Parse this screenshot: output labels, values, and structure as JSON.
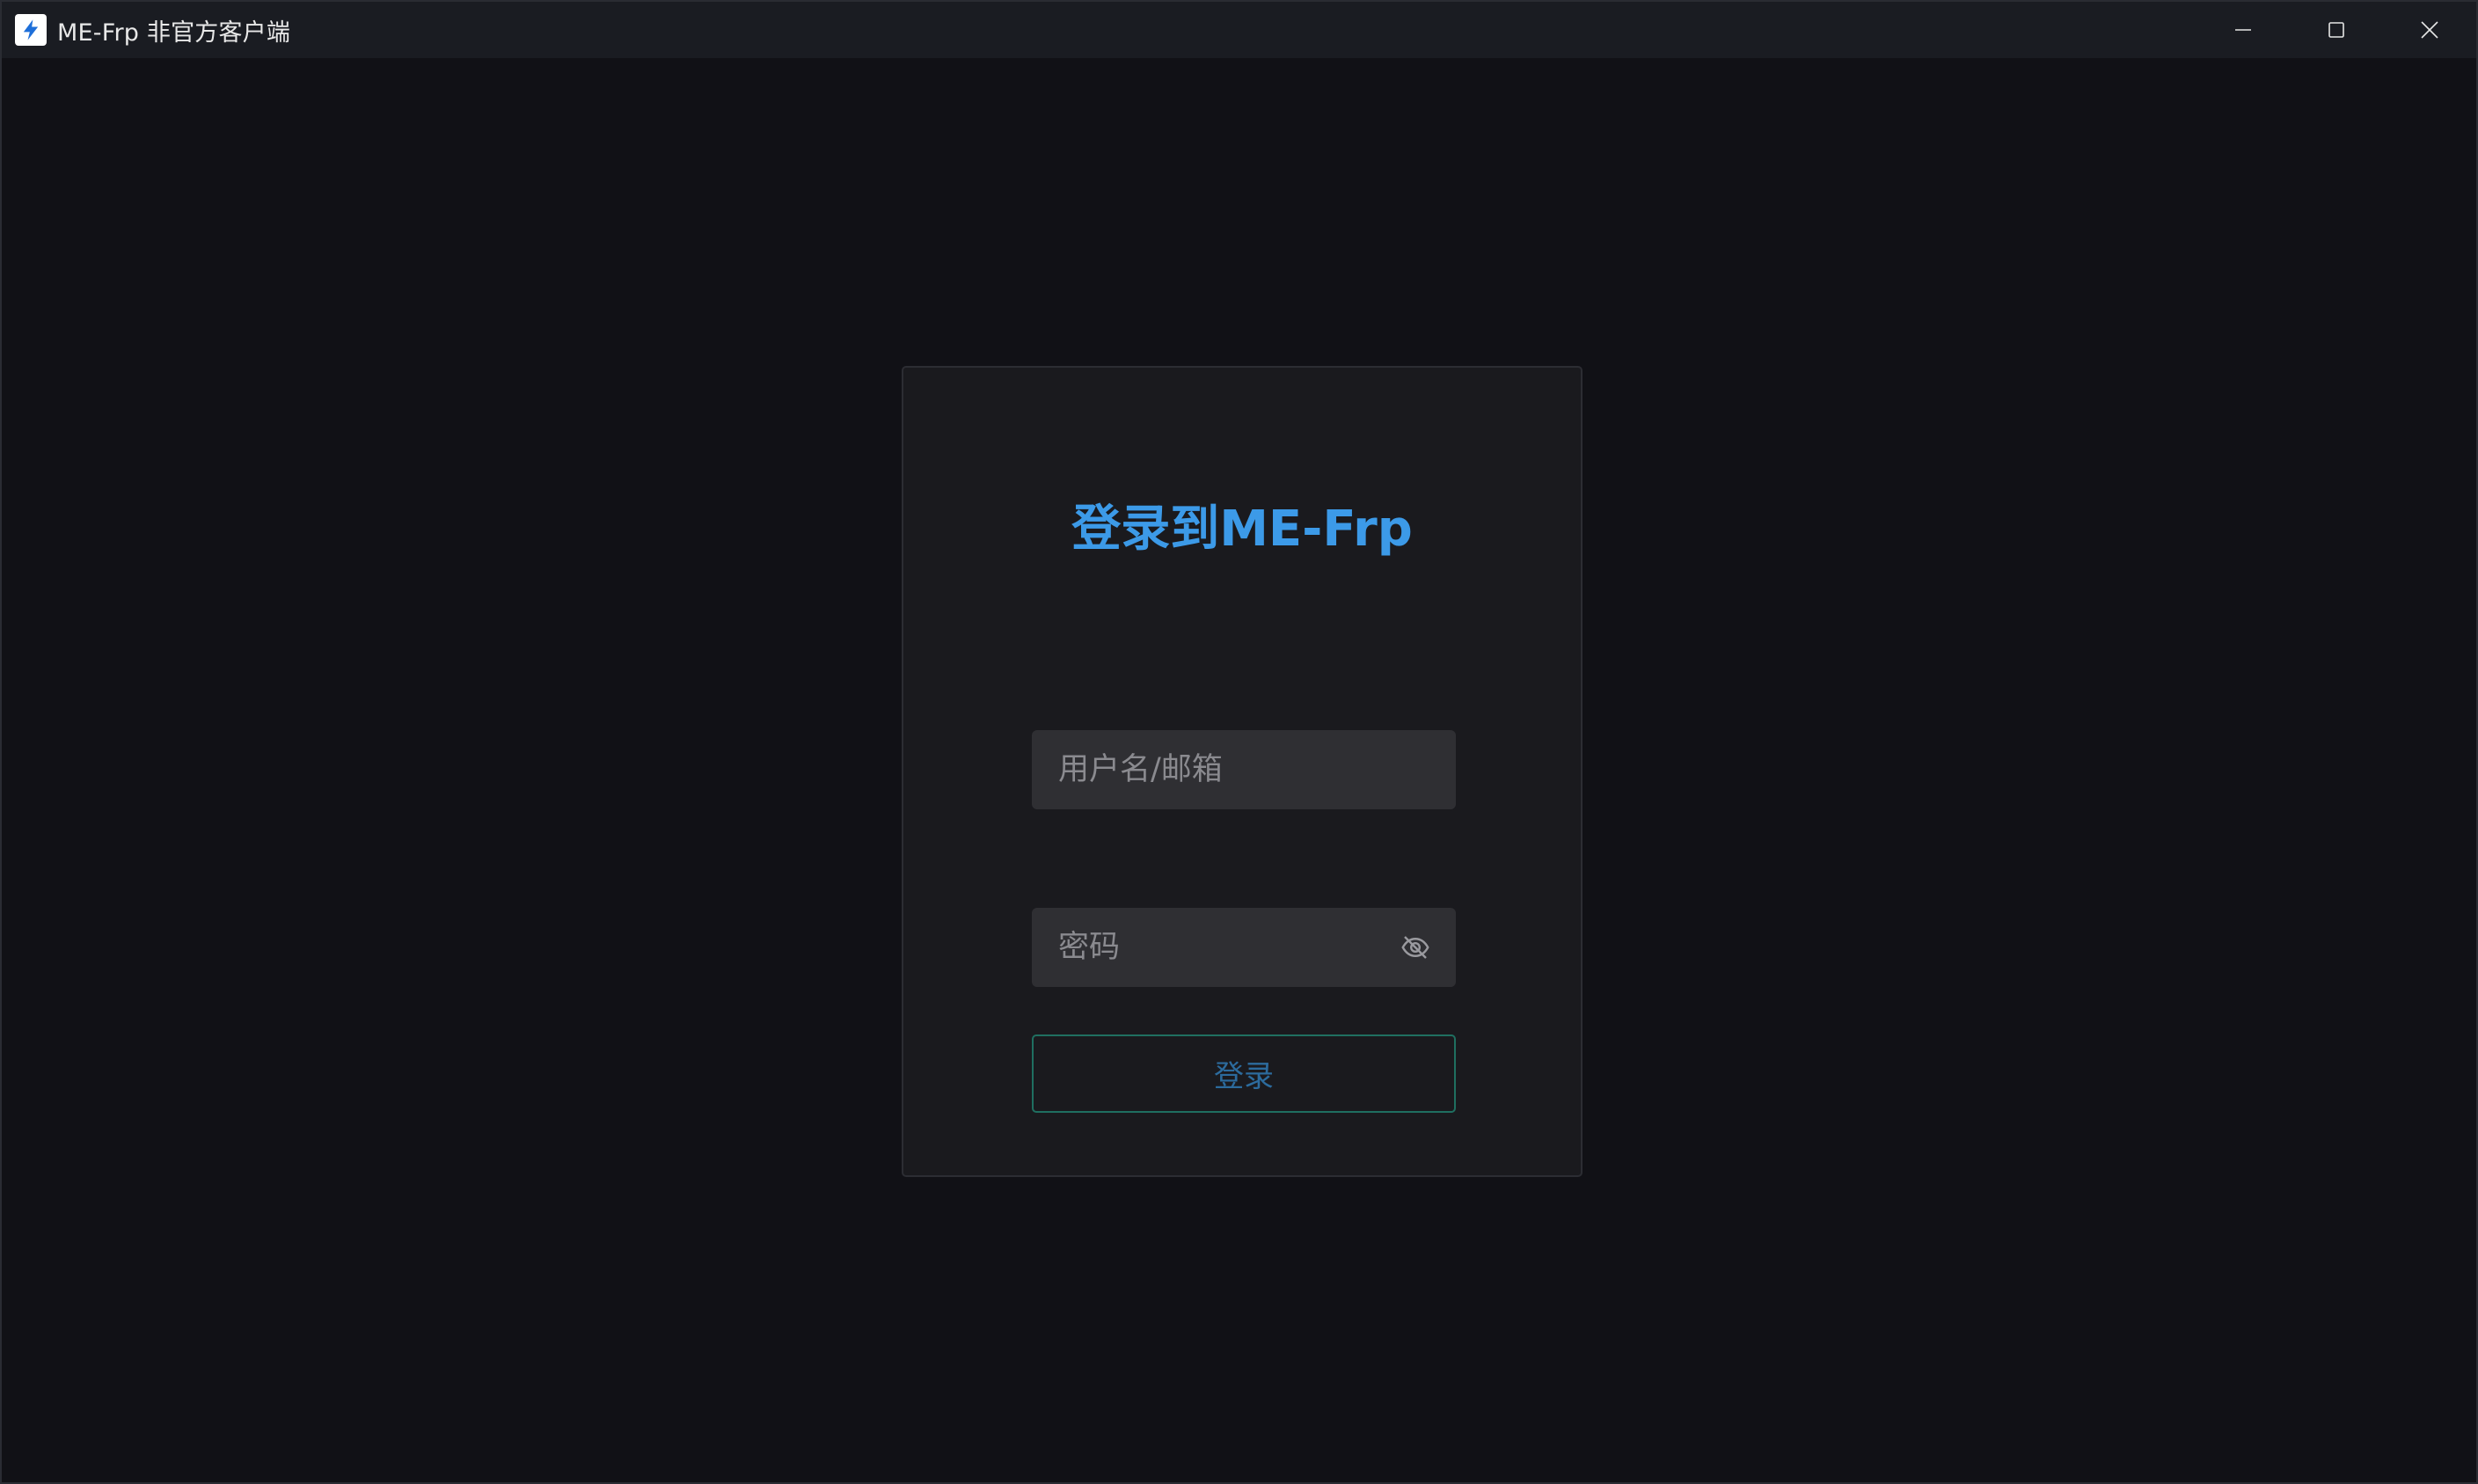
{
  "window": {
    "title": "ME-Frp 非官方客户端",
    "app_icon": "lightning-bolt-icon",
    "controls": {
      "minimize_icon": "minimize-icon",
      "maximize_icon": "maximize-icon",
      "close_icon": "close-icon"
    }
  },
  "login": {
    "heading": "登录到ME-Frp",
    "username": {
      "placeholder": "用户名/邮箱",
      "value": ""
    },
    "password": {
      "placeholder": "密码",
      "value": "",
      "toggle_icon": "eye-off-icon"
    },
    "submit_label": "登录"
  },
  "colors": {
    "accent": "#3c9ae8",
    "button_border": "#1f6f60",
    "button_text": "#2c6b9d",
    "background": "#111116",
    "card": "#1a1a1e",
    "input": "#2f2f33"
  }
}
